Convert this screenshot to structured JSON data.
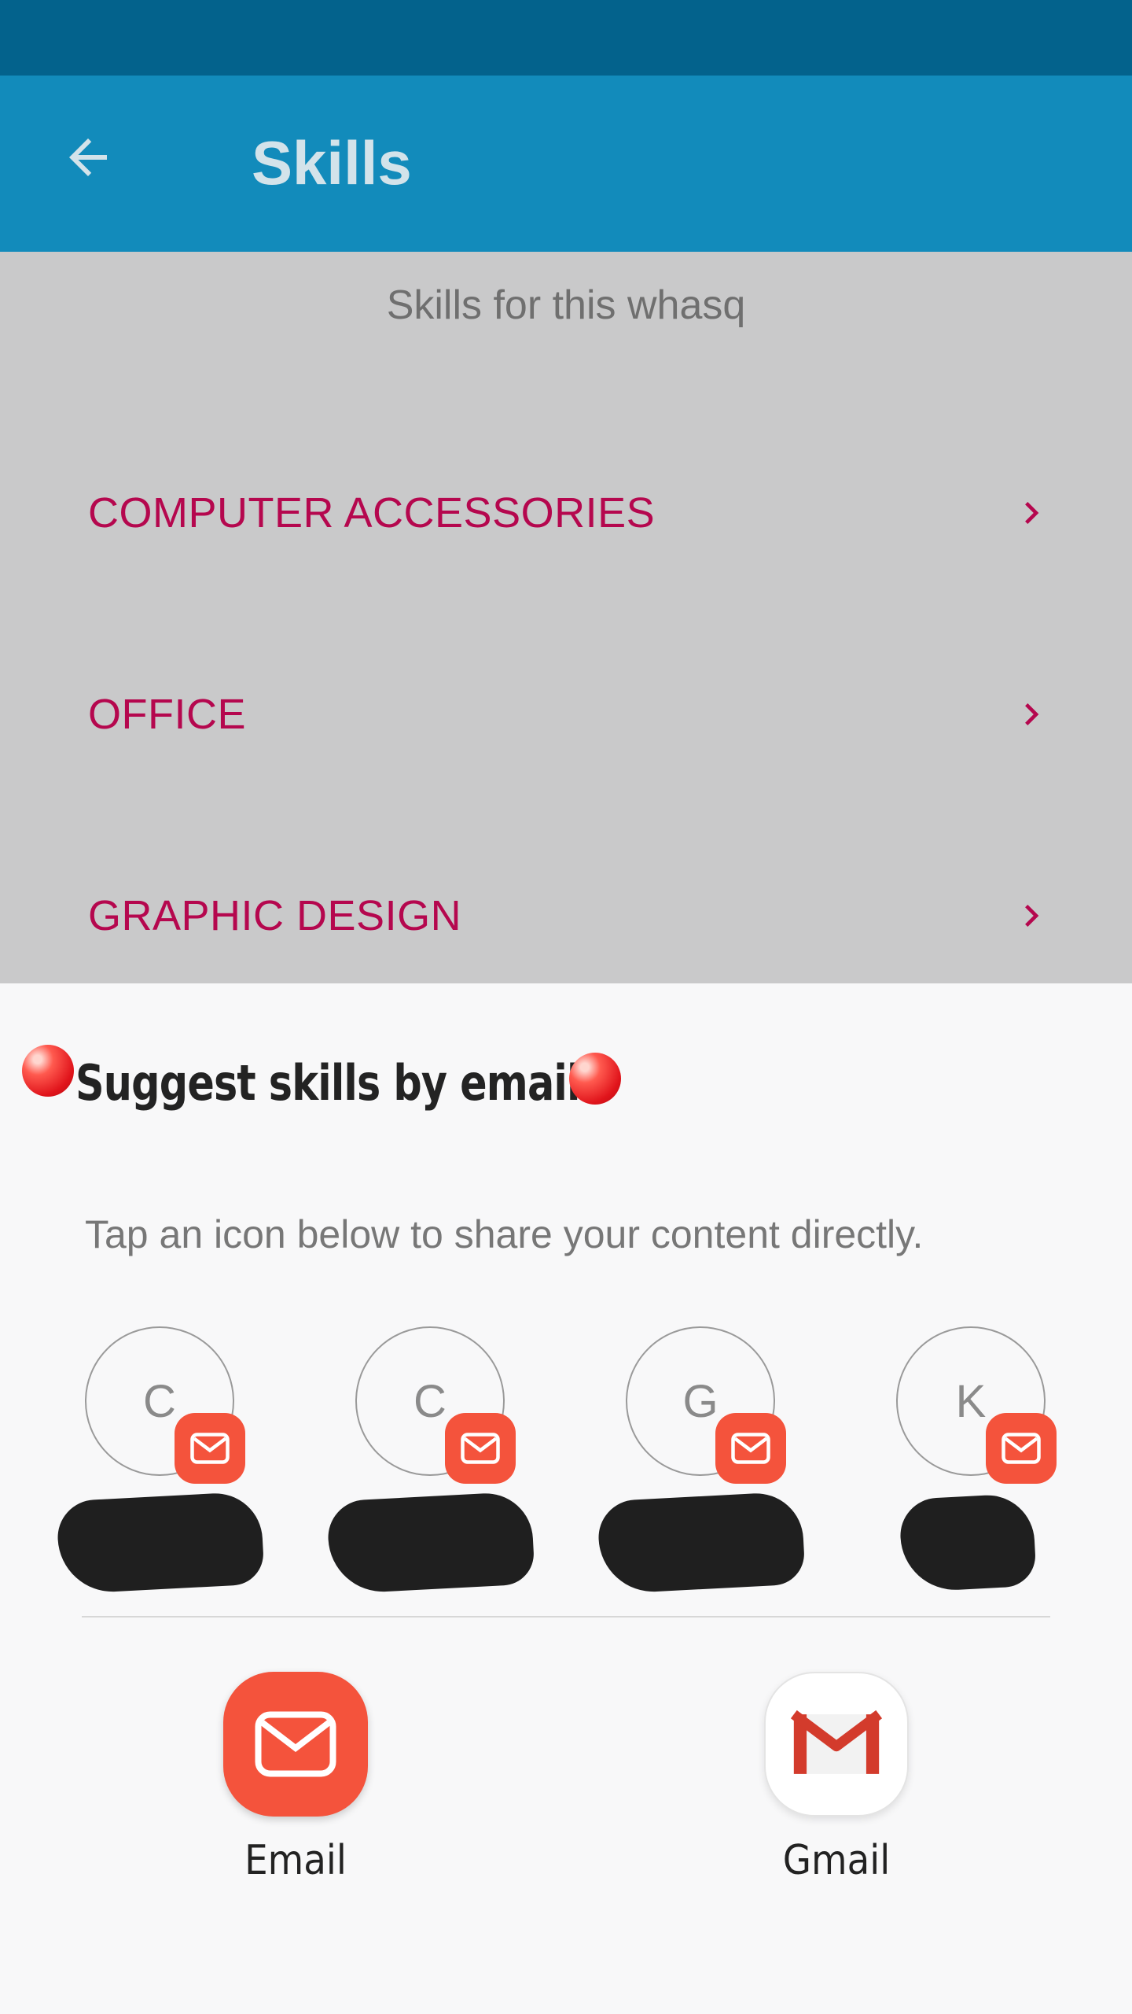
{
  "app_bar": {
    "title": "Skills"
  },
  "subtitle": "Skills for this whasq",
  "skills": [
    {
      "label": "COMPUTER ACCESSORIES"
    },
    {
      "label": "OFFICE"
    },
    {
      "label": "GRAPHIC DESIGN"
    }
  ],
  "share_sheet": {
    "title": "Suggest skills by email",
    "hint": "Tap an icon below to share your content directly.",
    "contacts": [
      {
        "initial": "C"
      },
      {
        "initial": "C"
      },
      {
        "initial": "G"
      },
      {
        "initial": "K"
      }
    ],
    "apps": [
      {
        "label": "Email"
      },
      {
        "label": "Gmail"
      }
    ]
  },
  "colors": {
    "status_bar": "#03628c",
    "app_bar": "#128bbb",
    "skill_text": "#b5074e",
    "email_icon": "#f4533c"
  }
}
